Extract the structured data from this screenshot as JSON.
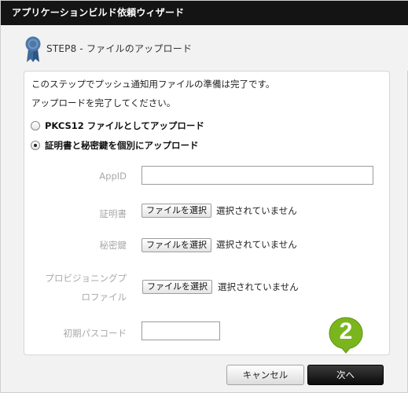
{
  "window": {
    "title": "アプリケーションビルド依頼ウィザード"
  },
  "step": {
    "label": "STEP8 - ファイルのアップロード",
    "icon": "ribbon-award-icon"
  },
  "instructions": {
    "line1": "このステップでプッシュ通知用ファイルの準備は完了です。",
    "line2": "アップロードを完了してください。"
  },
  "upload_options": [
    {
      "label": "PKCS12 ファイルとしてアップロード",
      "selected": false
    },
    {
      "label": "証明書と秘密鍵を個別にアップロード",
      "selected": true
    }
  ],
  "form": {
    "appid_label": "AppID",
    "appid_value": "",
    "certificate_label": "証明書",
    "private_key_label": "秘密鍵",
    "provisioning_label_line1": "プロビジョニングプ",
    "provisioning_label_line2": "ロファイル",
    "initial_passcode_label": "初期パスコード",
    "initial_passcode_value": "",
    "choose_file_label": "ファイルを選択",
    "no_file_selected": "選択されていません"
  },
  "annotation": {
    "number": "2",
    "color": "#7ab51d"
  },
  "buttons": {
    "cancel": "キャンセル",
    "next": "次へ"
  },
  "colors": {
    "titlebar": "#141414",
    "ribbon": "#4a6f9c",
    "primary_button": "#1a1a1a"
  }
}
